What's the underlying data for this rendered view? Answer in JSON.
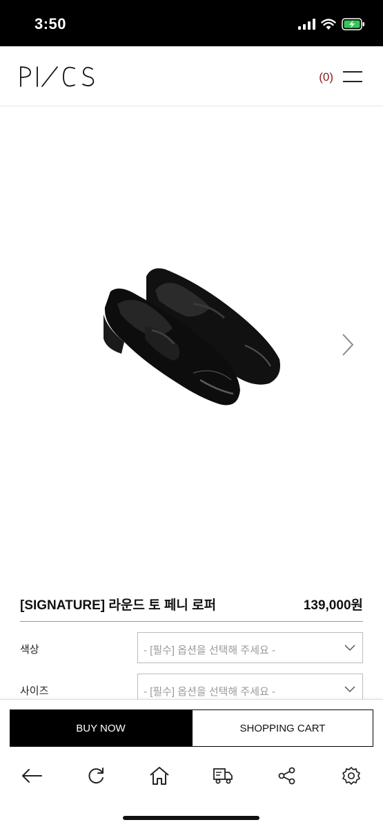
{
  "status_bar": {
    "time": "3:50",
    "icons": [
      "signal-icon",
      "wifi-icon",
      "battery-charging-icon"
    ],
    "battery_color": "#34c759"
  },
  "header": {
    "logo_text": "PI/CS",
    "cart_count": "(0)",
    "cart_count_color": "#8b1a1a",
    "menu_icon": "menu-icon"
  },
  "product": {
    "image_icon": "penny-loafer-shoes-image",
    "next_icon": "chevron-right-icon",
    "name": "[SIGNATURE] 라운드 토 페니 로퍼",
    "price": "139,000원"
  },
  "options": [
    {
      "label": "색상",
      "placeholder": "- [필수] 옵션을 선택해 주세요 -"
    },
    {
      "label": "사이즈",
      "placeholder": "- [필수] 옵션을 선택해 주세요 -"
    }
  ],
  "actions": {
    "buy_now": "BUY NOW",
    "shopping_cart": "SHOPPING CART"
  },
  "browser_nav": {
    "icons": [
      "back-arrow-icon",
      "refresh-icon",
      "home-icon",
      "delivery-truck-icon",
      "share-icon",
      "settings-gear-icon"
    ]
  }
}
